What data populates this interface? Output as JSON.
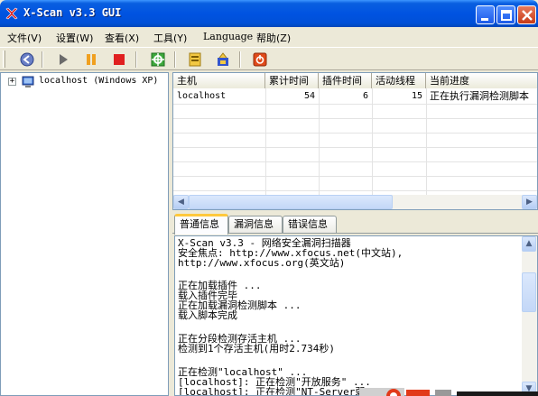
{
  "window": {
    "title": "X-Scan v3.3 GUI"
  },
  "menu": [
    {
      "label": "文件(V)"
    },
    {
      "label": "设置(W)"
    },
    {
      "label": "查看(X)"
    },
    {
      "label": "工具(Y)"
    },
    {
      "label": "Language"
    },
    {
      "label": "帮助(Z)"
    }
  ],
  "toolbar": {
    "buttons": [
      {
        "name": "connect-icon"
      },
      {
        "name": "start-icon"
      },
      {
        "name": "pause-icon"
      },
      {
        "name": "stop-icon"
      },
      {
        "name": "config-icon"
      },
      {
        "name": "vuln-icon"
      },
      {
        "name": "report-icon"
      },
      {
        "name": "exit-icon"
      }
    ]
  },
  "tree": {
    "expander": "+",
    "host_label": "localhost (Windows XP)"
  },
  "list": {
    "columns": [
      "主机",
      "累计时间",
      "插件时间",
      "活动线程",
      "当前进度"
    ],
    "rows": [
      {
        "host": "localhost",
        "total_time": "54",
        "plugin_time": "6",
        "threads": "15",
        "progress": "正在执行漏洞检测脚本"
      }
    ]
  },
  "tabs": [
    {
      "label": "普通信息",
      "active": true
    },
    {
      "label": "漏洞信息",
      "active": false
    },
    {
      "label": "错误信息",
      "active": false
    }
  ],
  "log": {
    "lines": [
      "X-Scan v3.3 - 网络安全漏洞扫描器",
      "安全焦点: http://www.xfocus.net(中文站),",
      "http://www.xfocus.org(英文站)",
      "",
      "正在加载插件 ...",
      "载入插件完毕",
      "正在加载漏洞检测脚本 ...",
      "载入脚本完成",
      "",
      "正在分段检测存活主机 ...",
      "检测到1个存活主机(用时2.734秒)",
      "",
      "正在检测\"localhost\" ...",
      "[localhost]: 正在检测\"开放服务\" ...",
      "[localhost]: 正在检测\"NT-Server弱"
    ]
  },
  "colors": {
    "titlebar": "#0053e1",
    "window_bg": "#ece9d8",
    "border": "#7f9db9",
    "active_tab_accent": "#ffc83c"
  }
}
